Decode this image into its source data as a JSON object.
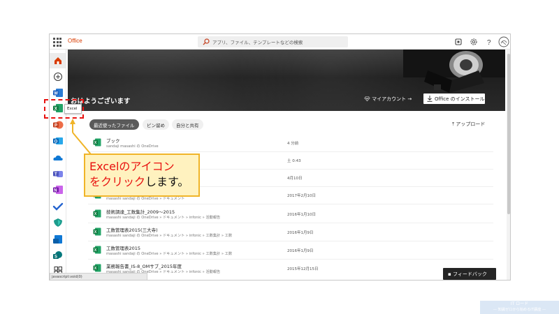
{
  "topbar": {
    "app_name": "Office",
    "search_placeholder": "アプリ、ファイル、テンプレートなどの検索",
    "icons": [
      "feedback-icon",
      "gear-icon",
      "help-icon",
      "avatar"
    ]
  },
  "rail": {
    "items": [
      "home-icon",
      "add-icon",
      "word-icon",
      "excel-icon",
      "powerpoint-icon",
      "outlook-icon",
      "onedrive-icon",
      "teams-icon",
      "onenote-icon",
      "todo-icon",
      "defender-icon",
      "sway-icon",
      "sharepoint-icon",
      "all-apps-icon"
    ]
  },
  "tooltip": {
    "label": "Excel"
  },
  "hero": {
    "greeting": "おはようございます",
    "account_link": "マイアカウント →",
    "install_button": "Office のインストール"
  },
  "tabs": [
    {
      "label": "最近使ったファイル",
      "active": true
    },
    {
      "label": "ピン留め",
      "active": false
    },
    {
      "label": "自分と共有",
      "active": false
    }
  ],
  "upload_label": "アップロード",
  "files": [
    {
      "name": "ブック",
      "path": "sandaji masashi の OneDrive",
      "date": "4 分前"
    },
    {
      "name": "",
      "path": "",
      "date": "土 0:43"
    },
    {
      "name": "",
      "path": "",
      "date": "4月10日"
    },
    {
      "name": "",
      "path": "masashi sandaji の OneDrive » ドキュメント",
      "date": "2017年2月10日"
    },
    {
      "name": "技術調達_工数集計_2009〜2015",
      "path": "masashi sandaji の OneDrive » ドキュメント » infonic » 活動報告",
      "date": "2016年1月10日"
    },
    {
      "name": "工数管理表2015(三大寺)",
      "path": "masashi sandaji の OneDrive » ドキュメント » infonic » 工数集計 » 工数",
      "date": "2016年1月9日"
    },
    {
      "name": "工数管理表2015",
      "path": "masashi sandaji の OneDrive » ドキュメント » infonic » 工数集計 » 工数",
      "date": "2016年1月9日"
    },
    {
      "name": "業務報告書_IS-8_OMサブ_2015年度",
      "path": "masashi sandaji の OneDrive » ドキュメント » infonic » 活動報告",
      "date": "2015年12月15日"
    }
  ],
  "feedback_button": "フィードバック",
  "status_text": "javascript:void(0)",
  "callout": {
    "line1_red": "Excelのアイコン",
    "line2_red": "をクリック",
    "line2_dark": "します。"
  },
  "watermark": {
    "line1": "IT ロード",
    "line2": "— 知識ゼロから始めるIT講座 —"
  },
  "colors": {
    "office_orange": "#d83b01",
    "excel_green": "#1d6f42",
    "callout_fill": "#fff2bf",
    "callout_border": "#f0b428",
    "highlight_red": "#e8110f"
  }
}
